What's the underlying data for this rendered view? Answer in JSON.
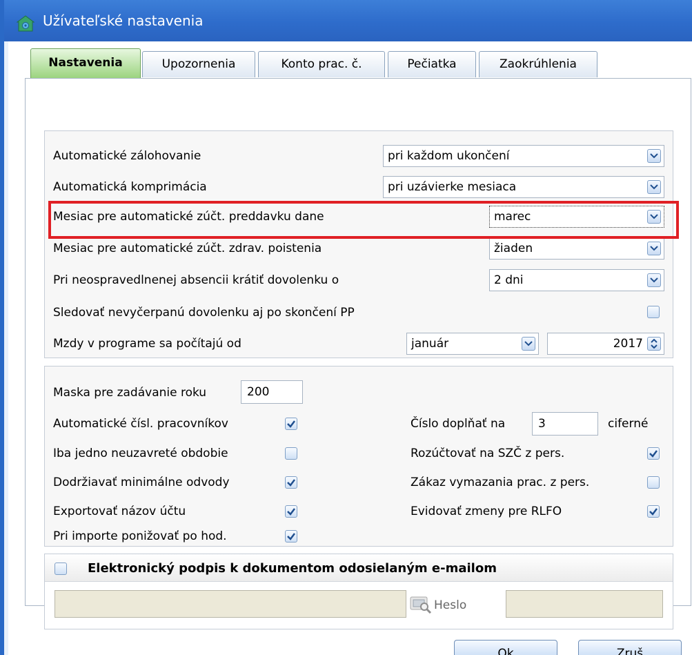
{
  "window": {
    "title": "Užívateľské nastavenia"
  },
  "tabs": [
    {
      "label": "Nastavenia",
      "active": true
    },
    {
      "label": "Upozornenia",
      "active": false
    },
    {
      "label": "Konto prac. č.",
      "active": false
    },
    {
      "label": "Pečiatka",
      "active": false
    },
    {
      "label": "Zaokrúhlenia",
      "active": false
    }
  ],
  "settings": {
    "auto_backup": {
      "label": "Automatické zálohovanie",
      "value": "pri každom ukončení"
    },
    "auto_compress": {
      "label": "Automatická komprimácia",
      "value": "pri uzávierke mesiaca"
    },
    "tax_month": {
      "label": "Mesiac pre automatické zúčt. preddavku dane",
      "value": "marec"
    },
    "health_month": {
      "label": "Mesiac pre automatické zúčt. zdrav. poistenia",
      "value": "žiaden"
    },
    "absence_cut": {
      "label": "Pri neospravedlnenej absencii krátiť dovolenku o",
      "value": "2 dni"
    },
    "track_vacation": {
      "label": "Sledovať nevyčerpanú dovolenku aj po skončení PP",
      "checked": false
    },
    "wages_from": {
      "label": "Mzdy v programe sa počítajú od",
      "month": "január",
      "year": "2017"
    }
  },
  "options": {
    "year_mask": {
      "label": "Maska pre zadávanie roku",
      "value": "200"
    },
    "auto_numbering": {
      "label": "Automatické čísl. pracovníkov",
      "checked": true
    },
    "one_open_period": {
      "label": "Iba jedno neuzavreté obdobie",
      "checked": false
    },
    "min_levies": {
      "label": "Dodržiavať minimálne odvody",
      "checked": true
    },
    "export_account_name": {
      "label": "Exportovať názov účtu",
      "checked": true
    },
    "import_lower": {
      "label": "Pri importe ponižovať po hod.",
      "checked": true
    },
    "pad_number": {
      "label": "Číslo doplňať na",
      "value": "3",
      "suffix": "ciferné"
    },
    "split_szc": {
      "label": "Rozúčtovať na SZČ z pers.",
      "checked": true
    },
    "no_delete": {
      "label": "Zákaz vymazania prac. z pers.",
      "checked": false
    },
    "track_rlfo": {
      "label": "Evidovať zmeny pre RLFO",
      "checked": true
    }
  },
  "esign": {
    "label": "Elektronický podpis k dokumentom odosielaným e-mailom",
    "checked": false,
    "password_label": "Heslo"
  },
  "buttons": {
    "ok": "Ok",
    "cancel": "Zruš"
  },
  "colors": {
    "accent": "#2a69c6",
    "highlight": "#e02025",
    "active_tab": "#9ad37d"
  }
}
